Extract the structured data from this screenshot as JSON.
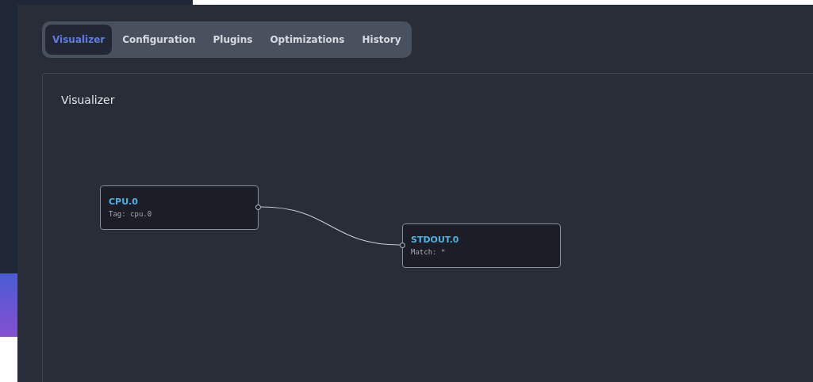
{
  "tabs": [
    {
      "label": "Visualizer",
      "selected": true
    },
    {
      "label": "Configuration",
      "selected": false
    },
    {
      "label": "Plugins",
      "selected": false
    },
    {
      "label": "Optimizations",
      "selected": false
    },
    {
      "label": "History",
      "selected": false
    }
  ],
  "panel": {
    "title": "Visualizer",
    "nodes": [
      {
        "name": "CPU.0",
        "detail": "Tag: cpu.0"
      },
      {
        "name": "STDOUT.0",
        "detail": "Match: *"
      }
    ]
  }
}
